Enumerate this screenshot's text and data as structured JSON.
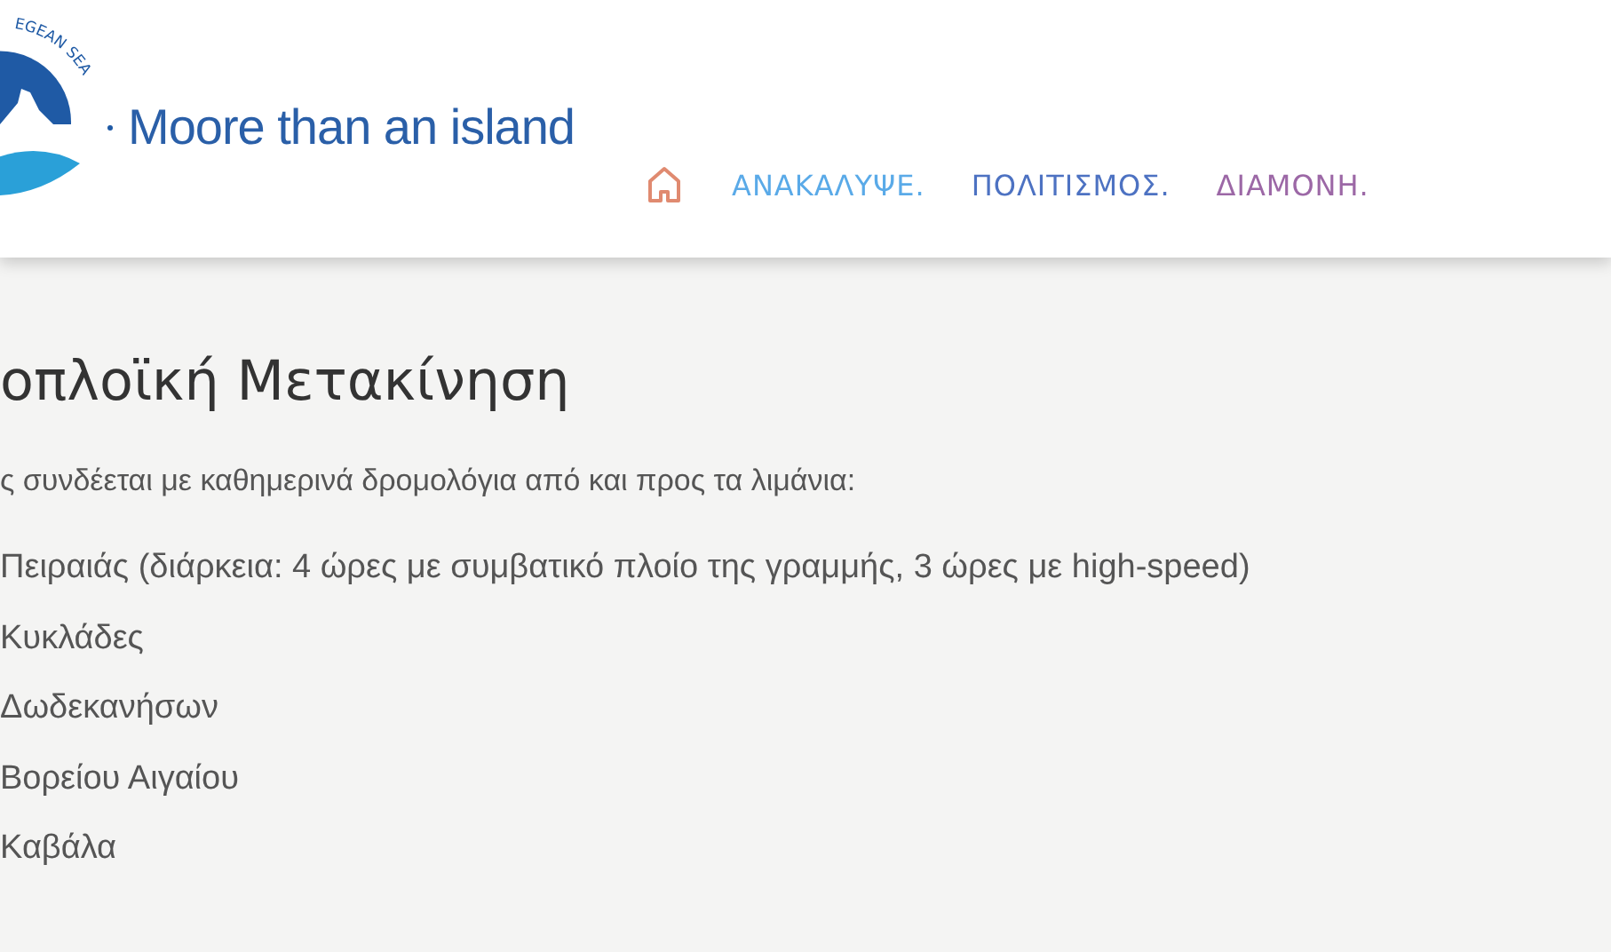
{
  "header": {
    "logo": {
      "arc_text": "EGEAN SEA",
      "tagline": "Moore than an island"
    },
    "nav": [
      {
        "label": "ΑΝΑΚΑΛΥΨΕ.",
        "color": "#5aaae8"
      },
      {
        "label": "ΠΟΛΙΤΙΣΜΟΣ.",
        "color": "#4d72c2"
      },
      {
        "label": "ΔΙΑΜΟΝΗ.",
        "color": "#9c68a6"
      }
    ]
  },
  "content": {
    "title": "οπλοϊκή Μετακίνηση",
    "intro": "ς συνδέεται με καθημερινά δρομολόγια από και προς τα λιμάνια:",
    "ports": [
      "Πειραιάς (διάρκεια: 4 ώρες με συμβατικό πλοίο της γραμμής, 3 ώρες με high-speed)",
      "Κυκλάδες",
      "Δωδεκανήσων",
      "Βορείου Αιγαίου",
      "Καβάλα"
    ]
  }
}
